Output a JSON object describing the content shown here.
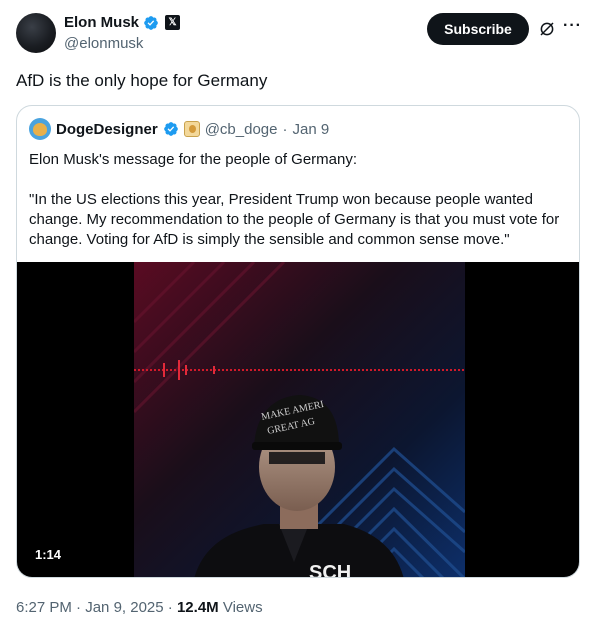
{
  "author": {
    "name": "Elon Musk",
    "handle": "@elonmusk",
    "verified_icon": "verified-badge-icon",
    "affiliate_icon": "x-logo-icon"
  },
  "actions": {
    "subscribe_label": "Subscribe",
    "grok_icon": "grok-icon",
    "more_icon": "more-icon"
  },
  "tweet": {
    "text": "AfD is the only hope for Germany"
  },
  "quoted": {
    "name": "DogeDesigner",
    "handle": "@cb_doge",
    "separator": "·",
    "date": "Jan 9",
    "line1": "Elon Musk's message for the people of Germany:",
    "line2": "\"In the US elections this year, President Trump won because people wanted change. My recommendation to the people of Germany is that you must vote for change. Voting for AfD is simply the sensible and common sense move.\"",
    "video": {
      "duration": "1:14",
      "hat_text_1": "MAKE AMERI",
      "hat_text_2": "GREAT AG",
      "shirt_text": "SCH"
    }
  },
  "meta": {
    "time": "6:27 PM",
    "separator": "·",
    "date": "Jan 9, 2025",
    "separator2": "·",
    "views_count": "12.4M",
    "views_label": "Views"
  }
}
